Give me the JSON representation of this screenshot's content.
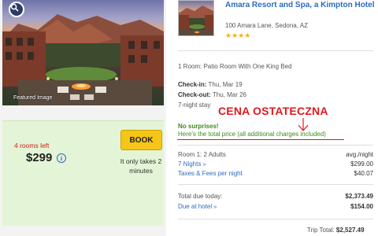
{
  "left": {
    "featured_label": "Featured Image",
    "rooms_left": "4 rooms left",
    "price": "$299",
    "info_glyph": "i",
    "book_label": "BOOK",
    "takes_line1": "It only takes 2",
    "takes_line2": "minutes"
  },
  "hotel": {
    "name": "Amara Resort and Spa, a Kimpton Hotel",
    "address": "100 Amara Lane, Sedona, AZ",
    "stars": "★★★★"
  },
  "booking": {
    "room_type": "1 Room: Patio Room With One King Bed",
    "checkin_label": "Check-in:",
    "checkin_value": "Thu, Mar 19",
    "checkout_label": "Check-out:",
    "checkout_value": "Thu, Mar 26",
    "stay": "7-night stay"
  },
  "annotation": {
    "text": "CENA OSTATECZNA",
    "color": "#e0191d"
  },
  "price_note": {
    "headline": "No surprises!",
    "detail": "Here's the total price (all additional charges included)"
  },
  "breakdown": {
    "room_label": "Room 1:",
    "room_adults": "2 Adults",
    "avg_label": "avg./night",
    "nights_label": "7 Nights",
    "nights_amount": "$299.00",
    "taxes_label": "Taxes & Fees per night",
    "taxes_amount": "$40.07",
    "due_today_label": "Total due today:",
    "due_today_amount": "$2,373.49",
    "due_hotel_label": "Due at hotel",
    "due_hotel_amount": "$154.00",
    "trip_total_label": "Trip Total:",
    "trip_total_amount": "$2,527.49",
    "expand_glyph": "»"
  },
  "colors": {
    "accent_link": "#2b6bc2",
    "book_button": "#f5c518",
    "success_green": "#3c8b1b",
    "alert_red": "#d0201a"
  }
}
